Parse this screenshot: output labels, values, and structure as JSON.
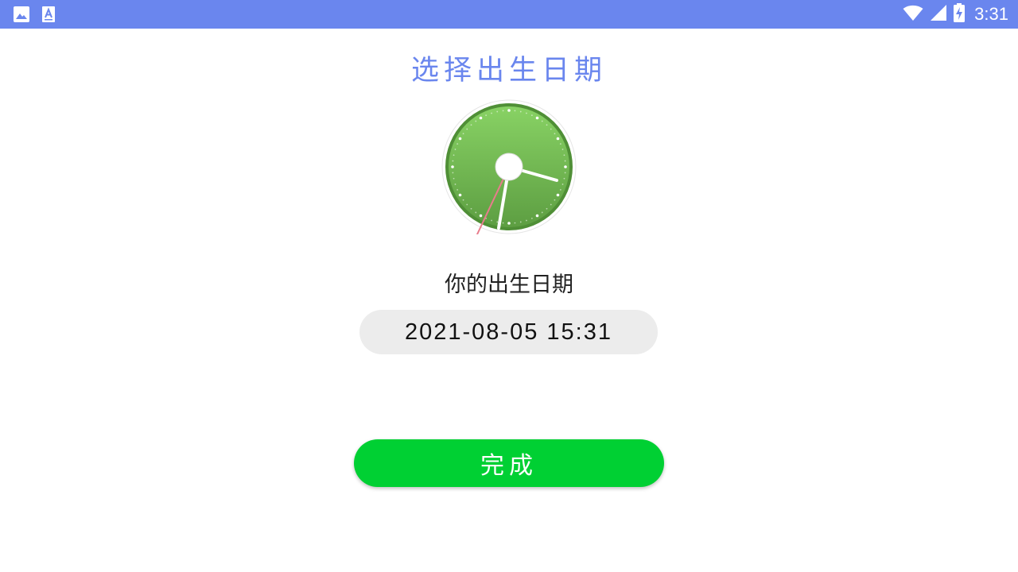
{
  "status_bar": {
    "time": "3:31",
    "left_icons": [
      "image-icon",
      "text-icon"
    ],
    "right_icons": [
      "wifi-icon",
      "signal-icon",
      "battery-icon"
    ],
    "background_color": "#6a86ee"
  },
  "page": {
    "title": "选择出生日期",
    "clock_icon": "clock-icon",
    "birth_label": "你的出生日期",
    "birth_datetime": "2021-08-05 15:31",
    "done_label": "完成"
  },
  "colors": {
    "accent": "#6a86ee",
    "button_green": "#00d033",
    "pill_gray": "#ececec",
    "clock_green": "#6fbd4f"
  }
}
